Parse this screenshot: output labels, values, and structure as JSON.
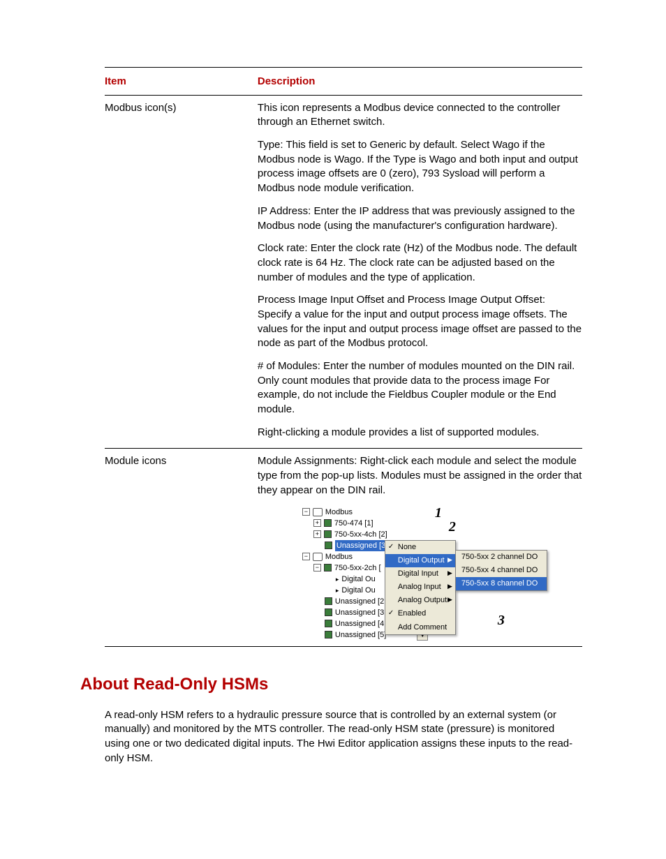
{
  "table": {
    "headers": {
      "item": "Item",
      "description": "Description"
    },
    "row1": {
      "item": "Modbus icon(s)",
      "p1": "This icon represents a Modbus device connected to the controller through an Ethernet switch.",
      "p2": "Type: This field is set to Generic by default. Select Wago if the Modbus node is Wago. If the Type is Wago and both input and output process image offsets are 0 (zero), 793 Sysload will perform a Modbus node module verification.",
      "p3": "IP Address: Enter the IP address that was previously assigned to the Modbus node (using the manufacturer's configuration hardware).",
      "p4": "Clock rate: Enter the clock rate (Hz) of the Modbus node. The default clock rate is 64 Hz. The clock rate can be adjusted based on the number of modules and the type of application.",
      "p5": "Process Image Input Offset and Process Image Output Offset: Specify a value for the input and output process image offsets. The values for the input and output process image offset are passed to the node as part of the Modbus protocol.",
      "p6": "# of Modules: Enter the number of modules mounted on the DIN rail. Only count modules that provide data to the process image For example, do not include the Fieldbus Coupler module or the End module.",
      "p7": "Right-clicking a module provides a list of supported modules."
    },
    "row2": {
      "item": "Module icons",
      "p1": "Module Assignments: Right-click each module and select the module type from the pop-up lists. Modules must be assigned in the order that they appear on the DIN rail."
    }
  },
  "tree": {
    "modbus1": "Modbus",
    "n1": "750-474 [1]",
    "n2": "750-5xx-4ch [2]",
    "n3": "Unassigned [3]",
    "modbus2": "Modbus",
    "n4": "750-5xx-2ch [",
    "n5a": "Digital Ou",
    "n5b": "Digital Ou",
    "n6": "Unassigned [2",
    "n7": "Unassigned [3",
    "n8": "Unassigned [4",
    "n9": "Unassigned [5]"
  },
  "popup": {
    "none": "None",
    "digout": "Digital Output",
    "digin": "Digital Input",
    "anain": "Analog Input",
    "anaout": "Analog Output",
    "enabled": "Enabled",
    "addc": "Add Comment"
  },
  "submenu": {
    "s1": "750-5xx 2 channel DO",
    "s2": "750-5xx 4 channel DO",
    "s3": "750-5xx 8 channel DO"
  },
  "callouts": {
    "c1": "1",
    "c2": "2",
    "c3": "3"
  },
  "section": {
    "title": "About Read-Only HSMs",
    "para": "A read-only HSM refers to a hydraulic pressure source that is controlled by an external system (or manually) and monitored by the MTS controller. The read-only HSM state (pressure) is monitored using one or two dedicated digital inputs. The Hwi Editor application assigns these inputs to the read-only HSM."
  }
}
